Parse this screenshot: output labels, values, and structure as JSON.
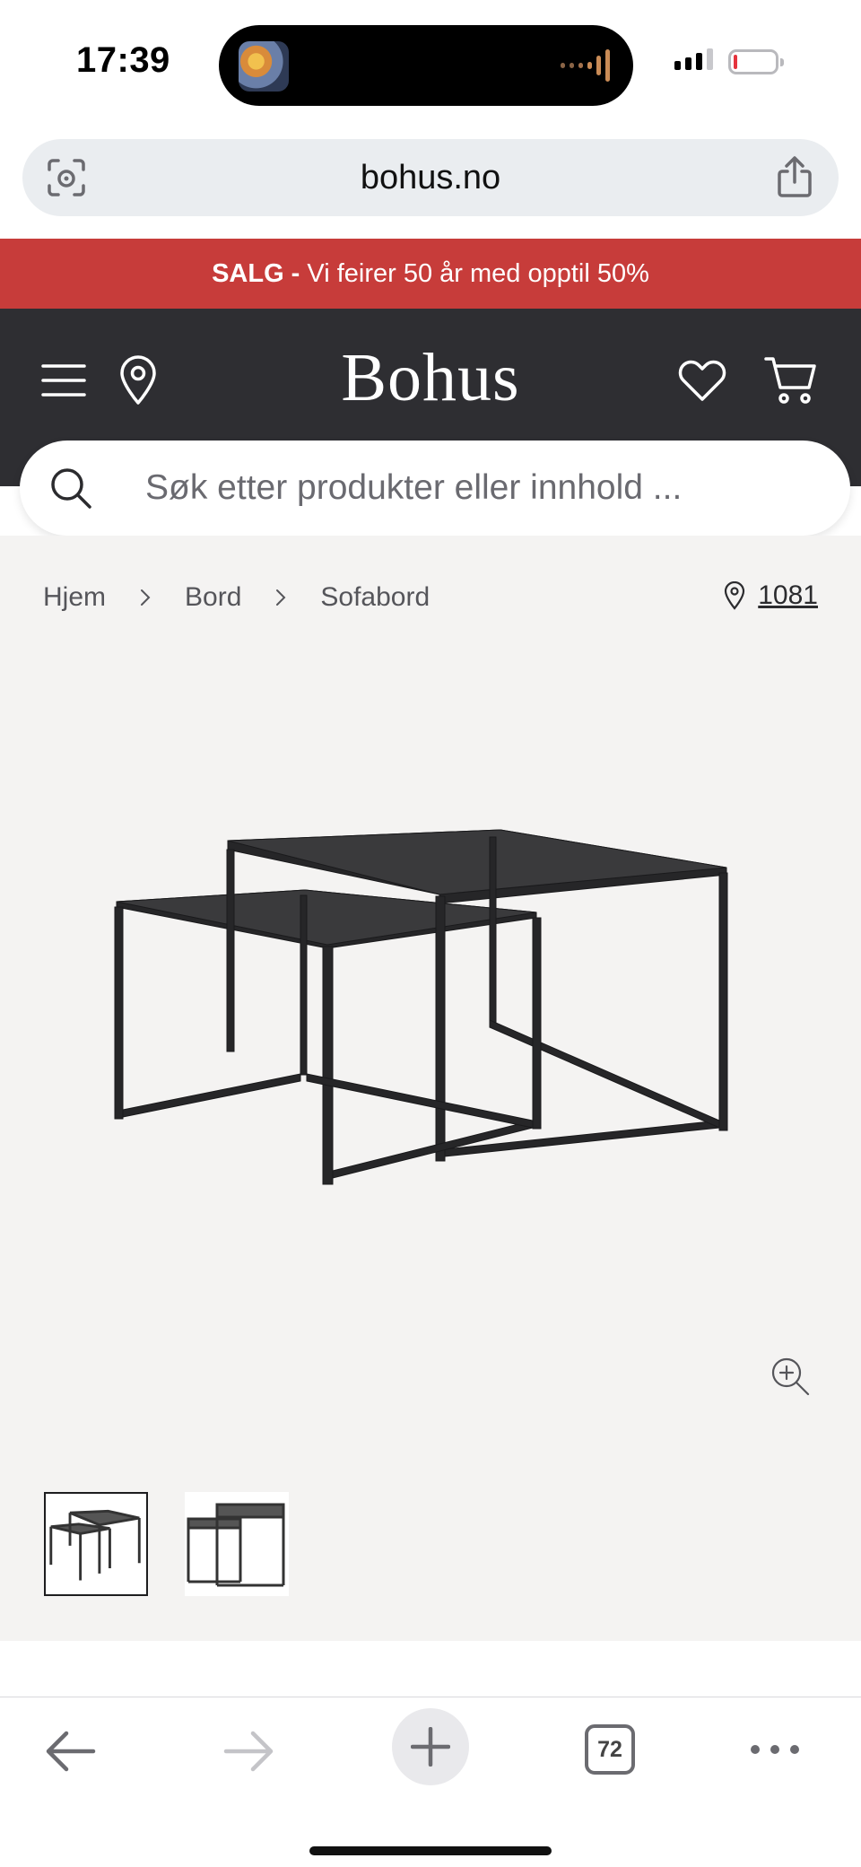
{
  "status_bar": {
    "time": "17:39",
    "signal_bars": 3,
    "signal_total": 4,
    "battery_level": 0.08
  },
  "browser": {
    "url": "bohus.no",
    "tab_count": "72"
  },
  "promo": {
    "bold": "SALG -",
    "text": "Vi feirer 50 år med opptil 50%",
    "color": "#c73c3a"
  },
  "header": {
    "logo": "Bohus",
    "background": "#2e2e32"
  },
  "search": {
    "placeholder": "Søk etter produkter eller innhold ..."
  },
  "breadcrumb": {
    "items": [
      "Hjem",
      "Bord",
      "Sofabord"
    ]
  },
  "postal": {
    "code": "1081"
  },
  "product": {
    "images": [
      {
        "label": "thumbnail-1",
        "active": true
      },
      {
        "label": "thumbnail-2",
        "active": false
      }
    ]
  }
}
